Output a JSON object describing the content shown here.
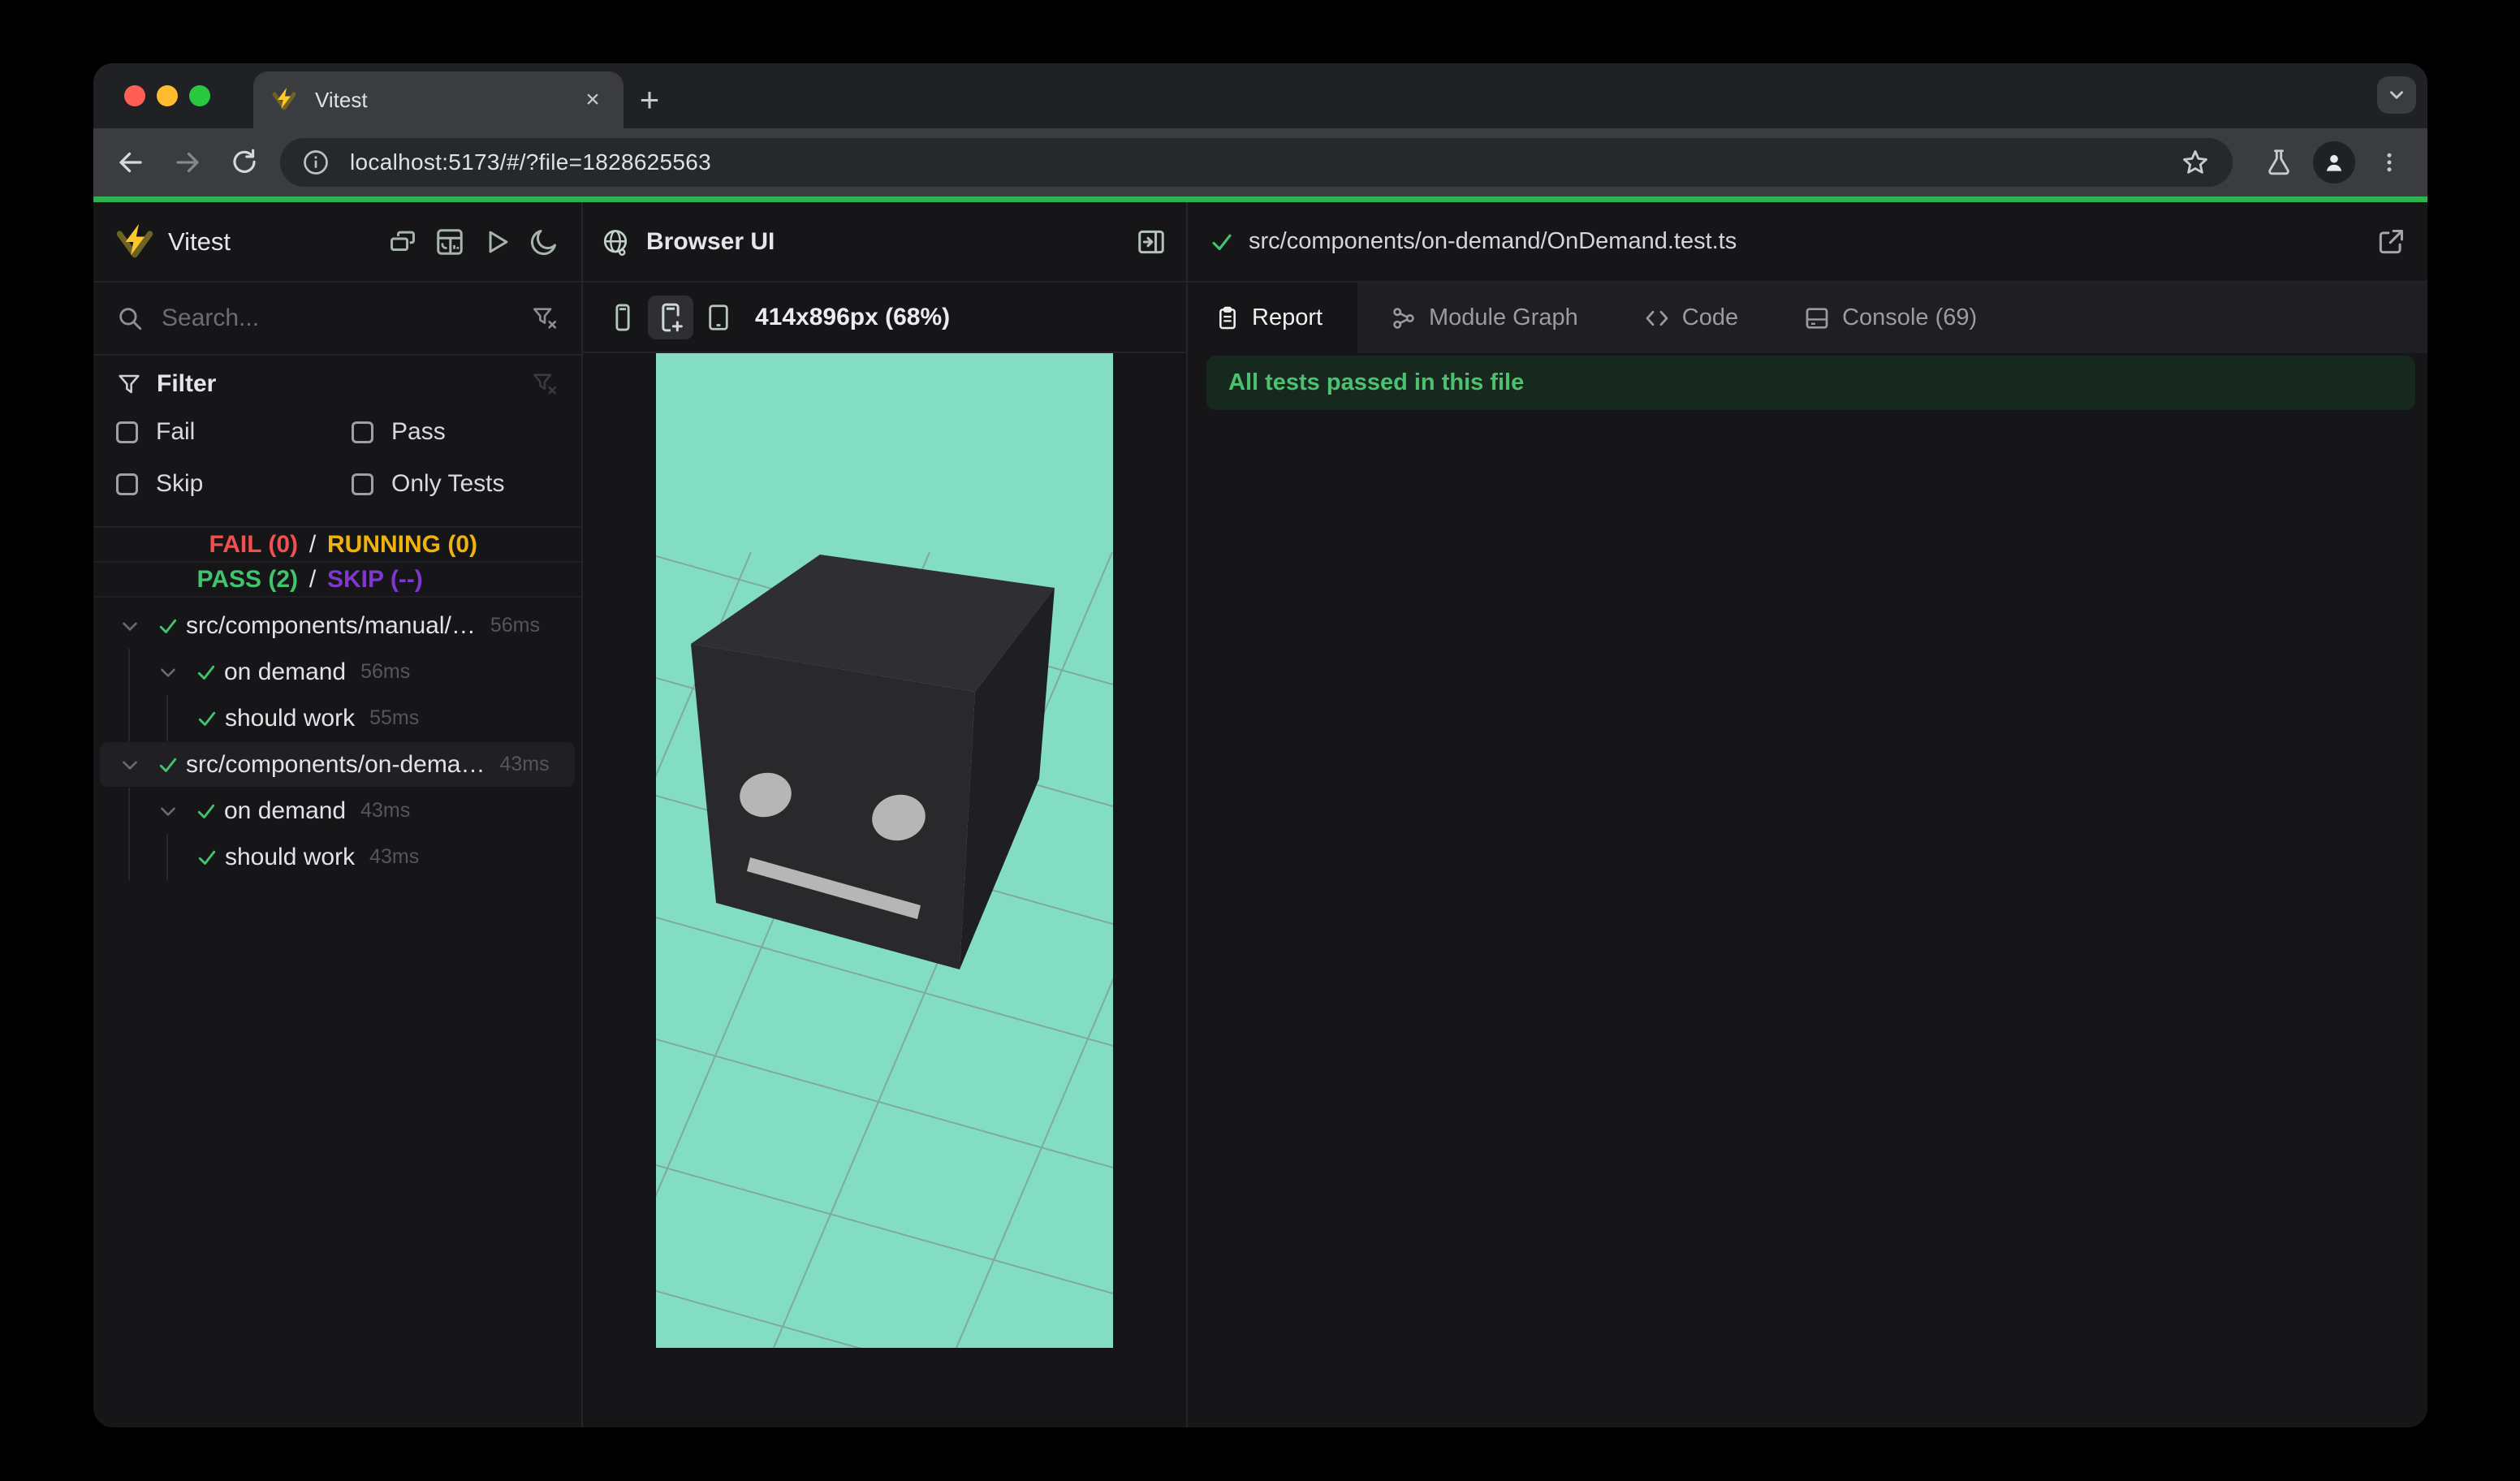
{
  "browser": {
    "tab_title": "Vitest",
    "url": "localhost:5173/#/?file=1828625563",
    "close_glyph": "×",
    "new_tab_glyph": "+"
  },
  "sidebar": {
    "app_title": "Vitest",
    "search_placeholder": "Search...",
    "filter": {
      "title": "Filter",
      "options": [
        "Fail",
        "Pass",
        "Skip",
        "Only Tests"
      ]
    },
    "stats": {
      "fail": "FAIL (0)",
      "running": "RUNNING (0)",
      "pass": "PASS (2)",
      "skip": "SKIP (--)",
      "separator": "/"
    },
    "tree": [
      {
        "label": "src/components/manual/…",
        "duration": "56ms",
        "level": 1,
        "selected": false
      },
      {
        "label": "on demand",
        "duration": "56ms",
        "level": 2,
        "selected": false
      },
      {
        "label": "should work",
        "duration": "55ms",
        "level": 3,
        "selected": false
      },
      {
        "label": "src/components/on-dema…",
        "duration": "43ms",
        "level": 1,
        "selected": true
      },
      {
        "label": "on demand",
        "duration": "43ms",
        "level": 2,
        "selected": false
      },
      {
        "label": "should work",
        "duration": "43ms",
        "level": 3,
        "selected": false
      }
    ]
  },
  "preview": {
    "title": "Browser UI",
    "size_label": "414x896px (68%)"
  },
  "detail": {
    "file_path": "src/components/on-demand/OnDemand.test.ts",
    "tabs": [
      {
        "label": "Report",
        "active": true
      },
      {
        "label": "Module Graph",
        "active": false
      },
      {
        "label": "Code",
        "active": false
      },
      {
        "label": "Console (69)",
        "active": false
      }
    ],
    "banner": "All tests passed in this file"
  },
  "colors": {
    "accent_green_line": "#2eb14f",
    "pass_green": "#41c46c",
    "fail_red": "#f25050",
    "running_yellow": "#eeb30e",
    "skip_purple": "#8036cf",
    "viewport_teal": "#83ddc3",
    "banner_bg": "#17291e",
    "banner_text": "#4cc16f",
    "vitest_bolt_yellow": "#fcc72b"
  },
  "icons": [
    "vitest-logo",
    "close",
    "new-tab",
    "chevron-down",
    "back-arrow",
    "forward-arrow",
    "reload",
    "info",
    "star",
    "flask",
    "profile",
    "kebab-menu",
    "cascade-windows",
    "dashboard",
    "play",
    "moon",
    "search",
    "funnel",
    "funnel-clear",
    "checkbox",
    "check",
    "globe",
    "panel-right",
    "phone-narrow",
    "phone-new",
    "tablet",
    "clipboard",
    "module-graph",
    "code-brackets",
    "console-window",
    "external-link"
  ]
}
